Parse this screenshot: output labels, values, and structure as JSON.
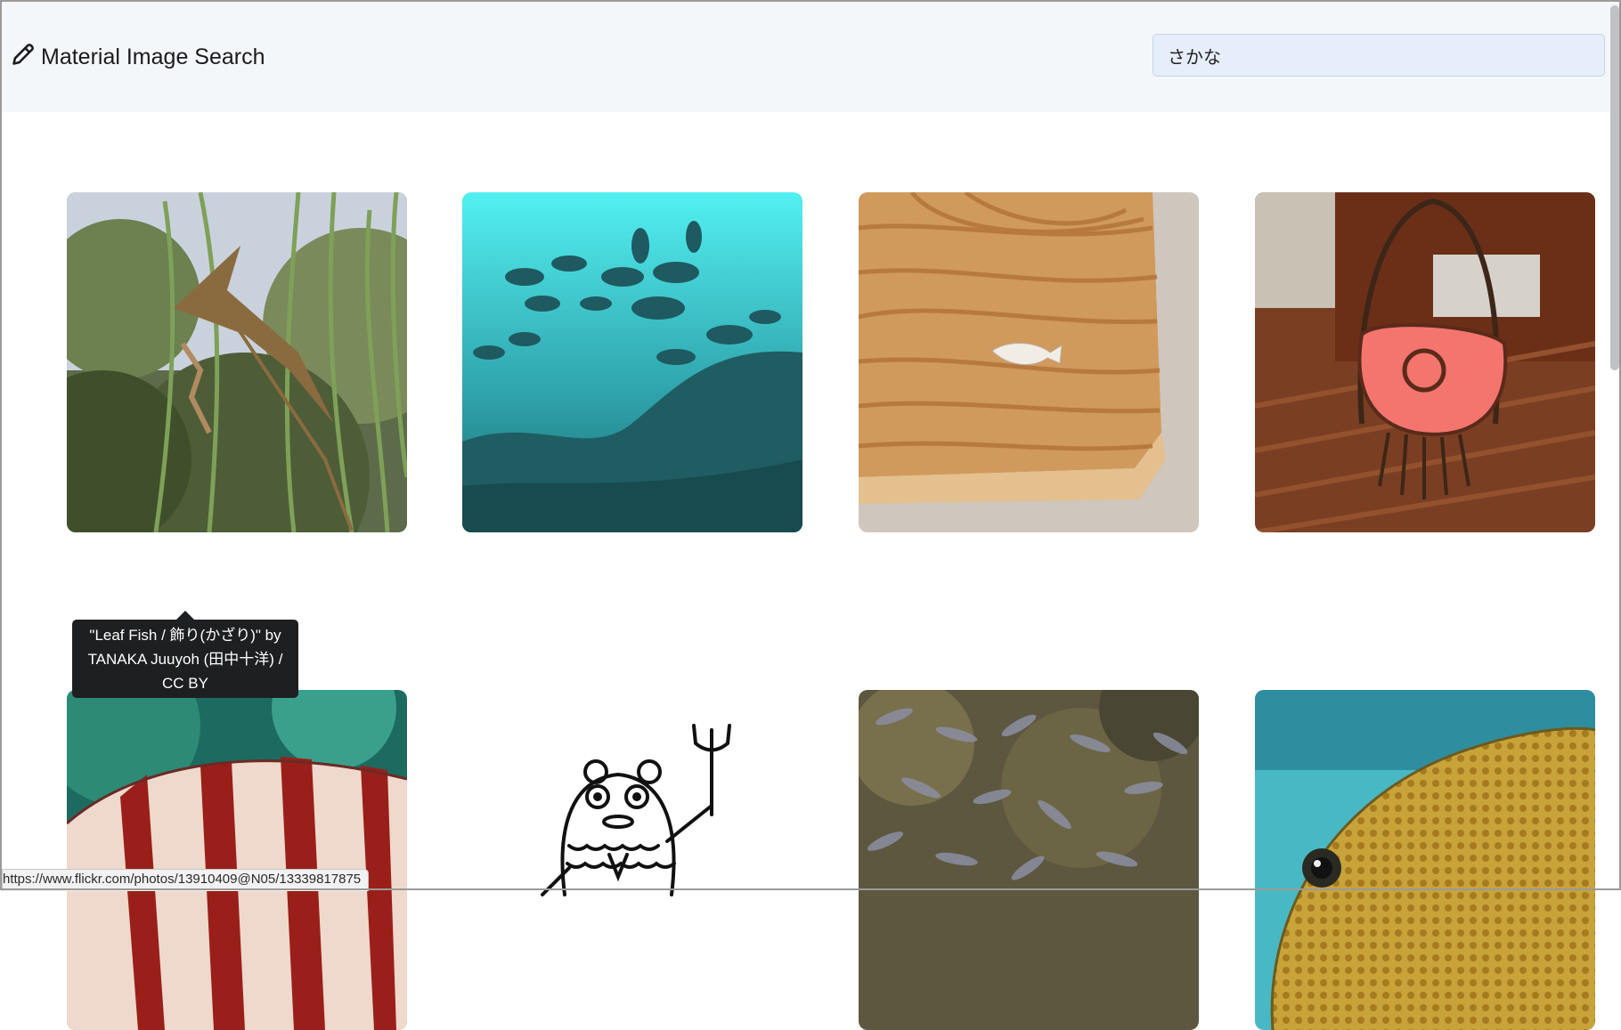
{
  "header": {
    "brand_icon": "pencil-icon",
    "title": "Material Image Search",
    "search_value": "さかな"
  },
  "results": [
    {
      "id": "leaf-fish",
      "thumbnail": "leaf-fish-photo"
    },
    {
      "id": "school-of-fish",
      "thumbnail": "school-of-fish-photo"
    },
    {
      "id": "fish-on-wood",
      "thumbnail": "wooden-fish-photo"
    },
    {
      "id": "fish-chair",
      "thumbnail": "fish-chair-photo"
    },
    {
      "id": "striped-fish",
      "thumbnail": "striped-fish-photo"
    },
    {
      "id": "fish-drawing",
      "thumbnail": "fish-character-drawing"
    },
    {
      "id": "fish-swarm",
      "thumbnail": "fish-swarm-photo"
    },
    {
      "id": "spotted-fish",
      "thumbnail": "spotted-fish-photo"
    }
  ],
  "tooltip": {
    "line1": "\"Leaf Fish / 飾り(かざり)\" by",
    "line2": "TANAKA Juuyoh (田中十洋) /",
    "line3": "CC BY"
  },
  "status_url": "https://www.flickr.com/photos/13910409@N05/13339817875"
}
